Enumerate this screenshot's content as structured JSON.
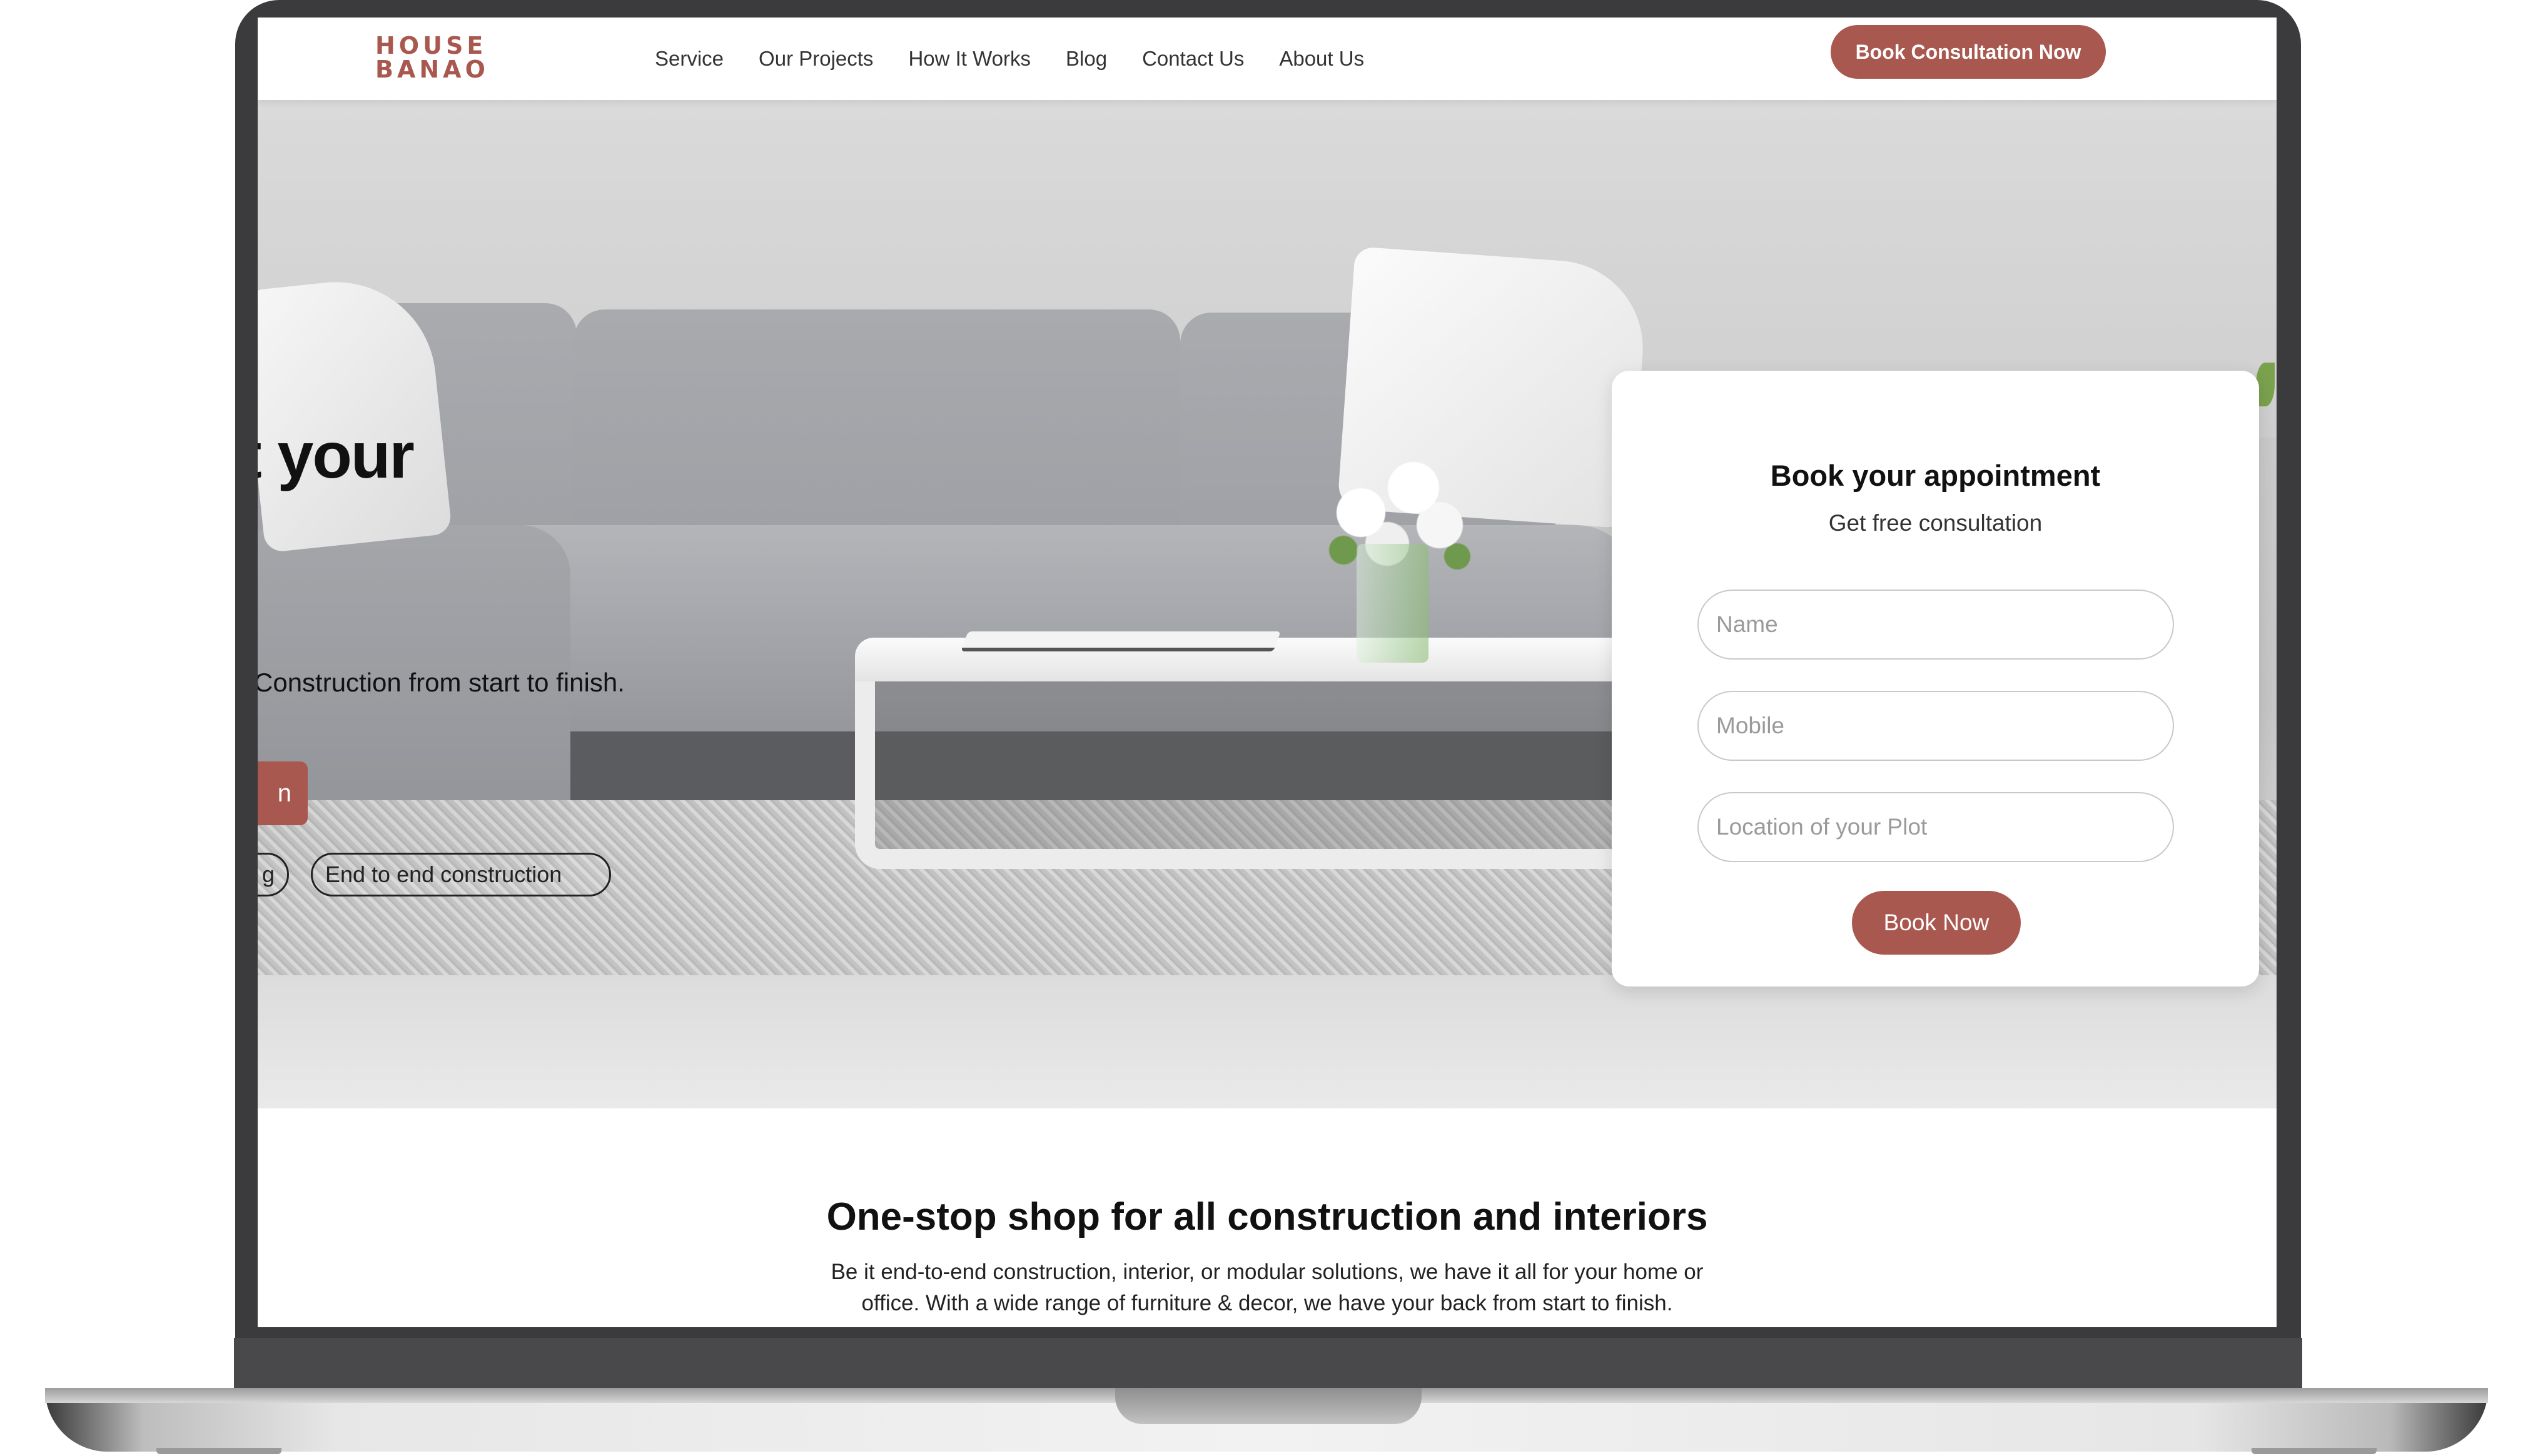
{
  "brand": {
    "logo_line1": "HOUSE",
    "logo_line2": "BANAO",
    "accent_color": "#a9584f"
  },
  "nav": {
    "links": [
      "Service",
      "Our Projects",
      "How It Works",
      "Blog",
      "Contact Us",
      "About Us"
    ],
    "cta_label": "Book Consultation Now"
  },
  "hero": {
    "heading_visible": "t your",
    "subtitle_visible": "Construction from start to finish.",
    "button_visible": "n",
    "tags": [
      "g",
      "End to end construction"
    ]
  },
  "booking": {
    "title": "Book your appointment",
    "subtitle": "Get free consultation",
    "name_placeholder": "Name",
    "mobile_placeholder": "Mobile",
    "location_placeholder": "Location of your Plot",
    "submit_label": "Book Now"
  },
  "section": {
    "title": "One-stop shop for all construction and interiors",
    "body": "Be it end-to-end construction, interior, or modular solutions, we have it all for your home or office. With a wide range of furniture & decor, we have your back from start to finish."
  }
}
